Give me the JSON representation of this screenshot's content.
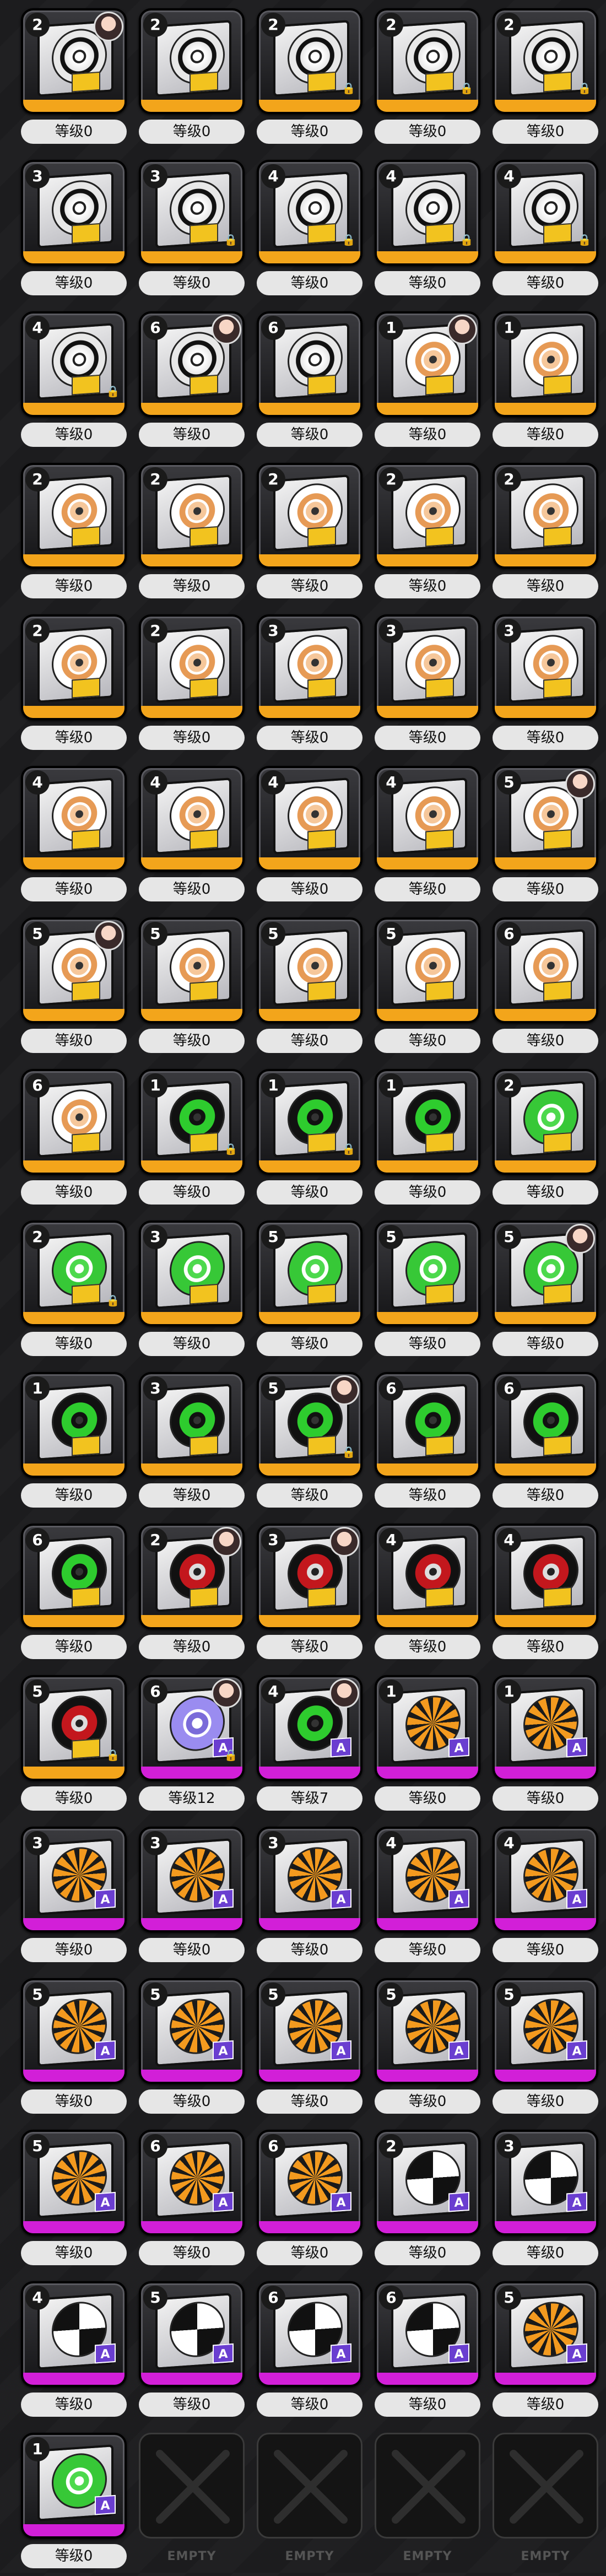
{
  "empty_label": "EMPTY",
  "colors": {
    "strip_yellow": "#f3a51b",
    "strip_magenta": "#d21fd8",
    "level_pill": "#e6e6e6"
  },
  "items": [
    {
      "stars": "2",
      "disc": "white",
      "strip": "yellow",
      "avatar": true,
      "lock": false,
      "level": "等级0"
    },
    {
      "stars": "2",
      "disc": "white",
      "strip": "yellow",
      "avatar": false,
      "lock": false,
      "level": "等级0"
    },
    {
      "stars": "2",
      "disc": "white",
      "strip": "yellow",
      "avatar": false,
      "lock": true,
      "level": "等级0"
    },
    {
      "stars": "2",
      "disc": "white",
      "strip": "yellow",
      "avatar": false,
      "lock": true,
      "level": "等级0"
    },
    {
      "stars": "2",
      "disc": "white",
      "strip": "yellow",
      "avatar": false,
      "lock": true,
      "level": "等级0"
    },
    {
      "stars": "3",
      "disc": "white",
      "strip": "yellow",
      "avatar": false,
      "lock": false,
      "level": "等级0"
    },
    {
      "stars": "3",
      "disc": "white",
      "strip": "yellow",
      "avatar": false,
      "lock": true,
      "level": "等级0"
    },
    {
      "stars": "4",
      "disc": "white",
      "strip": "yellow",
      "avatar": false,
      "lock": true,
      "level": "等级0"
    },
    {
      "stars": "4",
      "disc": "white",
      "strip": "yellow",
      "avatar": false,
      "lock": true,
      "level": "等级0"
    },
    {
      "stars": "4",
      "disc": "white",
      "strip": "yellow",
      "avatar": false,
      "lock": true,
      "level": "等级0"
    },
    {
      "stars": "4",
      "disc": "white",
      "strip": "yellow",
      "avatar": false,
      "lock": true,
      "level": "等级0"
    },
    {
      "stars": "6",
      "disc": "white",
      "strip": "yellow",
      "avatar": true,
      "lock": false,
      "level": "等级0"
    },
    {
      "stars": "6",
      "disc": "white",
      "strip": "yellow",
      "avatar": false,
      "lock": false,
      "level": "等级0"
    },
    {
      "stars": "1",
      "disc": "flower",
      "strip": "yellow",
      "avatar": true,
      "lock": false,
      "level": "等级0"
    },
    {
      "stars": "1",
      "disc": "flower",
      "strip": "yellow",
      "avatar": false,
      "lock": false,
      "level": "等级0"
    },
    {
      "stars": "2",
      "disc": "flower",
      "strip": "yellow",
      "avatar": false,
      "lock": false,
      "level": "等级0"
    },
    {
      "stars": "2",
      "disc": "flower",
      "strip": "yellow",
      "avatar": false,
      "lock": false,
      "level": "等级0"
    },
    {
      "stars": "2",
      "disc": "flower",
      "strip": "yellow",
      "avatar": false,
      "lock": false,
      "level": "等级0"
    },
    {
      "stars": "2",
      "disc": "flower",
      "strip": "yellow",
      "avatar": false,
      "lock": false,
      "level": "等级0"
    },
    {
      "stars": "2",
      "disc": "flower",
      "strip": "yellow",
      "avatar": false,
      "lock": false,
      "level": "等级0"
    },
    {
      "stars": "2",
      "disc": "flower",
      "strip": "yellow",
      "avatar": false,
      "lock": false,
      "level": "等级0"
    },
    {
      "stars": "2",
      "disc": "flower",
      "strip": "yellow",
      "avatar": false,
      "lock": false,
      "level": "等级0"
    },
    {
      "stars": "3",
      "disc": "flower",
      "strip": "yellow",
      "avatar": false,
      "lock": false,
      "level": "等级0"
    },
    {
      "stars": "3",
      "disc": "flower",
      "strip": "yellow",
      "avatar": false,
      "lock": false,
      "level": "等级0"
    },
    {
      "stars": "3",
      "disc": "flower",
      "strip": "yellow",
      "avatar": false,
      "lock": false,
      "level": "等级0"
    },
    {
      "stars": "4",
      "disc": "flower",
      "strip": "yellow",
      "avatar": false,
      "lock": false,
      "level": "等级0"
    },
    {
      "stars": "4",
      "disc": "flower",
      "strip": "yellow",
      "avatar": false,
      "lock": false,
      "level": "等级0"
    },
    {
      "stars": "4",
      "disc": "flower",
      "strip": "yellow",
      "avatar": false,
      "lock": false,
      "level": "等级0"
    },
    {
      "stars": "4",
      "disc": "flower",
      "strip": "yellow",
      "avatar": false,
      "lock": false,
      "level": "等级0"
    },
    {
      "stars": "5",
      "disc": "flower",
      "strip": "yellow",
      "avatar": true,
      "lock": false,
      "level": "等级0"
    },
    {
      "stars": "5",
      "disc": "flower",
      "strip": "yellow",
      "avatar": true,
      "lock": false,
      "level": "等级0"
    },
    {
      "stars": "5",
      "disc": "flower",
      "strip": "yellow",
      "avatar": false,
      "lock": false,
      "level": "等级0"
    },
    {
      "stars": "5",
      "disc": "flower",
      "strip": "yellow",
      "avatar": false,
      "lock": false,
      "level": "等级0"
    },
    {
      "stars": "5",
      "disc": "flower",
      "strip": "yellow",
      "avatar": false,
      "lock": false,
      "level": "等级0"
    },
    {
      "stars": "6",
      "disc": "flower",
      "strip": "yellow",
      "avatar": false,
      "lock": false,
      "level": "等级0"
    },
    {
      "stars": "6",
      "disc": "flower",
      "strip": "yellow",
      "avatar": false,
      "lock": false,
      "level": "等级0"
    },
    {
      "stars": "1",
      "disc": "darkgreen",
      "strip": "yellow",
      "avatar": false,
      "lock": true,
      "level": "等级0"
    },
    {
      "stars": "1",
      "disc": "darkgreen",
      "strip": "yellow",
      "avatar": false,
      "lock": true,
      "level": "等级0"
    },
    {
      "stars": "1",
      "disc": "darkgreen",
      "strip": "yellow",
      "avatar": false,
      "lock": false,
      "level": "等级0"
    },
    {
      "stars": "2",
      "disc": "green",
      "strip": "yellow",
      "avatar": false,
      "lock": false,
      "level": "等级0"
    },
    {
      "stars": "2",
      "disc": "green",
      "strip": "yellow",
      "avatar": false,
      "lock": true,
      "level": "等级0"
    },
    {
      "stars": "3",
      "disc": "green",
      "strip": "yellow",
      "avatar": false,
      "lock": false,
      "level": "等级0"
    },
    {
      "stars": "5",
      "disc": "green",
      "strip": "yellow",
      "avatar": false,
      "lock": false,
      "level": "等级0"
    },
    {
      "stars": "5",
      "disc": "green",
      "strip": "yellow",
      "avatar": false,
      "lock": false,
      "level": "等级0"
    },
    {
      "stars": "5",
      "disc": "green",
      "strip": "yellow",
      "avatar": true,
      "lock": false,
      "level": "等级0"
    },
    {
      "stars": "1",
      "disc": "darkgreen",
      "strip": "yellow",
      "avatar": false,
      "lock": false,
      "level": "等级0"
    },
    {
      "stars": "3",
      "disc": "darkgreen",
      "strip": "yellow",
      "avatar": false,
      "lock": false,
      "level": "等级0"
    },
    {
      "stars": "5",
      "disc": "darkgreen",
      "strip": "yellow",
      "avatar": true,
      "lock": true,
      "level": "等级0"
    },
    {
      "stars": "6",
      "disc": "darkgreen",
      "strip": "yellow",
      "avatar": false,
      "lock": false,
      "level": "等级0"
    },
    {
      "stars": "6",
      "disc": "darkgreen",
      "strip": "yellow",
      "avatar": false,
      "lock": false,
      "level": "等级0"
    },
    {
      "stars": "6",
      "disc": "darkgreen",
      "strip": "yellow",
      "avatar": false,
      "lock": false,
      "level": "等级0"
    },
    {
      "stars": "2",
      "disc": "red",
      "strip": "yellow",
      "avatar": true,
      "lock": false,
      "level": "等级0"
    },
    {
      "stars": "3",
      "disc": "red",
      "strip": "yellow",
      "avatar": true,
      "lock": false,
      "level": "等级0"
    },
    {
      "stars": "4",
      "disc": "red",
      "strip": "yellow",
      "avatar": false,
      "lock": false,
      "level": "等级0"
    },
    {
      "stars": "4",
      "disc": "red",
      "strip": "yellow",
      "avatar": false,
      "lock": false,
      "level": "等级0"
    },
    {
      "stars": "5",
      "disc": "red",
      "strip": "yellow",
      "avatar": false,
      "lock": true,
      "level": "等级0"
    },
    {
      "stars": "6",
      "disc": "purple",
      "strip": "magenta",
      "avatar": true,
      "lock": true,
      "level": "等级12"
    },
    {
      "stars": "4",
      "disc": "darkgreen",
      "strip": "magenta",
      "avatar": true,
      "lock": false,
      "level": "等级7"
    },
    {
      "stars": "1",
      "disc": "tiger",
      "strip": "magenta",
      "avatar": false,
      "lock": false,
      "level": "等级0"
    },
    {
      "stars": "1",
      "disc": "tiger",
      "strip": "magenta",
      "avatar": false,
      "lock": false,
      "level": "等级0"
    },
    {
      "stars": "3",
      "disc": "tiger",
      "strip": "magenta",
      "avatar": false,
      "lock": false,
      "level": "等级0"
    },
    {
      "stars": "3",
      "disc": "tiger",
      "strip": "magenta",
      "avatar": false,
      "lock": false,
      "level": "等级0"
    },
    {
      "stars": "3",
      "disc": "tiger",
      "strip": "magenta",
      "avatar": false,
      "lock": false,
      "level": "等级0"
    },
    {
      "stars": "4",
      "disc": "tiger",
      "strip": "magenta",
      "avatar": false,
      "lock": false,
      "level": "等级0"
    },
    {
      "stars": "4",
      "disc": "tiger",
      "strip": "magenta",
      "avatar": false,
      "lock": false,
      "level": "等级0"
    },
    {
      "stars": "5",
      "disc": "tiger",
      "strip": "magenta",
      "avatar": false,
      "lock": false,
      "level": "等级0"
    },
    {
      "stars": "5",
      "disc": "tiger",
      "strip": "magenta",
      "avatar": false,
      "lock": false,
      "level": "等级0"
    },
    {
      "stars": "5",
      "disc": "tiger",
      "strip": "magenta",
      "avatar": false,
      "lock": false,
      "level": "等级0"
    },
    {
      "stars": "5",
      "disc": "tiger",
      "strip": "magenta",
      "avatar": false,
      "lock": false,
      "level": "等级0"
    },
    {
      "stars": "5",
      "disc": "tiger",
      "strip": "magenta",
      "avatar": false,
      "lock": false,
      "level": "等级0"
    },
    {
      "stars": "5",
      "disc": "tiger",
      "strip": "magenta",
      "avatar": false,
      "lock": false,
      "level": "等级0"
    },
    {
      "stars": "6",
      "disc": "tiger",
      "strip": "magenta",
      "avatar": false,
      "lock": false,
      "level": "等级0"
    },
    {
      "stars": "6",
      "disc": "tiger",
      "strip": "magenta",
      "avatar": false,
      "lock": false,
      "level": "等级0"
    },
    {
      "stars": "2",
      "disc": "swirl",
      "strip": "magenta",
      "avatar": false,
      "lock": false,
      "level": "等级0"
    },
    {
      "stars": "3",
      "disc": "swirl",
      "strip": "magenta",
      "avatar": false,
      "lock": false,
      "level": "等级0"
    },
    {
      "stars": "4",
      "disc": "swirl",
      "strip": "magenta",
      "avatar": false,
      "lock": false,
      "level": "等级0"
    },
    {
      "stars": "5",
      "disc": "swirl",
      "strip": "magenta",
      "avatar": false,
      "lock": false,
      "level": "等级0"
    },
    {
      "stars": "6",
      "disc": "swirl",
      "strip": "magenta",
      "avatar": false,
      "lock": false,
      "level": "等级0"
    },
    {
      "stars": "6",
      "disc": "swirl",
      "strip": "magenta",
      "avatar": false,
      "lock": false,
      "level": "等级0"
    },
    {
      "stars": "5",
      "disc": "tiger",
      "strip": "magenta",
      "avatar": false,
      "lock": false,
      "level": "等级0"
    },
    {
      "stars": "1",
      "disc": "green",
      "strip": "magenta",
      "avatar": false,
      "lock": false,
      "level": "等级0"
    }
  ],
  "empty_count": 4
}
